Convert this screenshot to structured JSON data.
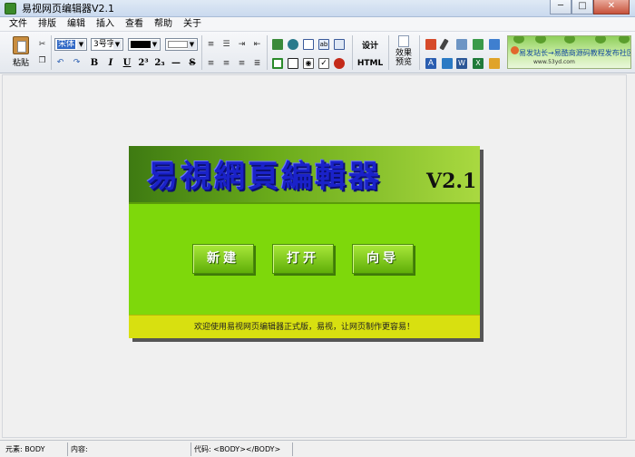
{
  "window": {
    "title": "易视网页编辑器V2.1",
    "minimize": "─",
    "maximize": "□",
    "close": "✕"
  },
  "menu": [
    "文件",
    "排版",
    "编辑",
    "插入",
    "查看",
    "帮助",
    "关于"
  ],
  "toolbar": {
    "paste_label": "粘贴",
    "font_name": "宋体",
    "font_size": "3号字",
    "design_label": "设计",
    "html_label": "HTML",
    "preview_label_1": "效果",
    "preview_label_2": "预览",
    "bold": "B",
    "italic": "I",
    "underline": "U",
    "superscript": "2³",
    "subscript": "2₃",
    "hr": "—",
    "strike": "S"
  },
  "banner": {
    "text": "易发站长→易酷商源码教程发布社区",
    "url": "www.53yd.com"
  },
  "splash": {
    "title": "易視網頁編輯器",
    "version": "V2.1",
    "buttons": [
      "新建",
      "打开",
      "向导"
    ],
    "footer": "欢迎使用易视网页编辑器正式版，易视，让网页制作更容易！"
  },
  "status": {
    "element": "元素: BODY",
    "content": "内容:",
    "code": "代码:  <BODY></BODY>"
  },
  "colors": {
    "splash_header": "#69aa1a",
    "splash_body": "#7ed80b",
    "splash_footer": "#d8e010",
    "title_blue": "#1a22c9"
  },
  "icons": [
    "cut-icon",
    "copy-icon",
    "undo-icon",
    "redo-icon",
    "align-left-icon",
    "align-center-icon",
    "align-right-icon",
    "justify-icon",
    "image-icon",
    "table-icon"
  ]
}
